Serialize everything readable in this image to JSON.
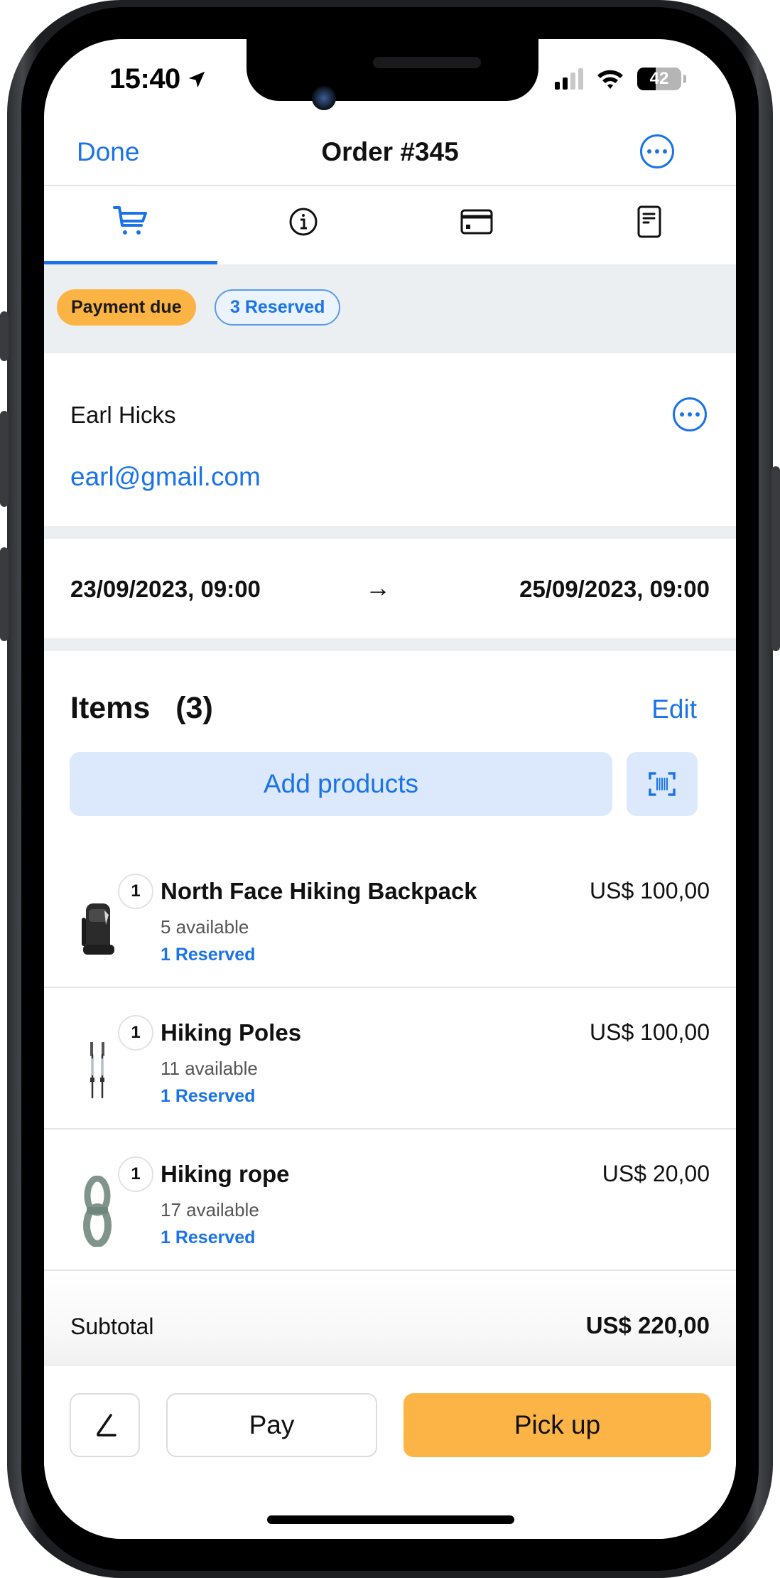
{
  "status_bar": {
    "time": "15:40",
    "location_icon": "location-arrow-icon",
    "signal_bars_active": 2,
    "signal_bars_total": 4,
    "wifi_icon": "wifi-icon",
    "battery_percent": "42"
  },
  "nav": {
    "done_label": "Done",
    "title": "Order #345",
    "more_icon": "more-circle-icon"
  },
  "tabs": [
    {
      "icon": "cart-icon",
      "active": true
    },
    {
      "icon": "info-icon",
      "active": false
    },
    {
      "icon": "credit-card-icon",
      "active": false
    },
    {
      "icon": "receipt-icon",
      "active": false
    }
  ],
  "badges": {
    "payment": "Payment due",
    "reserved": "3 Reserved"
  },
  "customer": {
    "name": "Earl Hicks",
    "email": "earl@gmail.com"
  },
  "dates": {
    "start": "23/09/2023, 09:00",
    "arrow": "→",
    "end": "25/09/2023, 09:00"
  },
  "items_section": {
    "title": "Items  (3)",
    "edit_label": "Edit",
    "add_products_label": "Add products",
    "scan_icon": "barcode-scan-icon"
  },
  "items": [
    {
      "qty": "1",
      "name": "North Face Hiking Backpack",
      "available": "5 available",
      "reserved": "1 Reserved",
      "price": "US$ 100,00",
      "thumb": "backpack"
    },
    {
      "qty": "1",
      "name": "Hiking Poles",
      "available": "11 available",
      "reserved": "1 Reserved",
      "price": "US$ 100,00",
      "thumb": "poles"
    },
    {
      "qty": "1",
      "name": "Hiking rope",
      "available": "17 available",
      "reserved": "1 Reserved",
      "price": "US$ 20,00",
      "thumb": "rope"
    }
  ],
  "subtotal": {
    "label": "Subtotal",
    "value": "US$ 220,00"
  },
  "actions": {
    "edit_icon": "pencil-icon",
    "pay_label": "Pay",
    "pickup_label": "Pick up"
  },
  "colors": {
    "accent": "#1a73e8",
    "warning": "#fbb343",
    "band": "#ebeff2"
  }
}
